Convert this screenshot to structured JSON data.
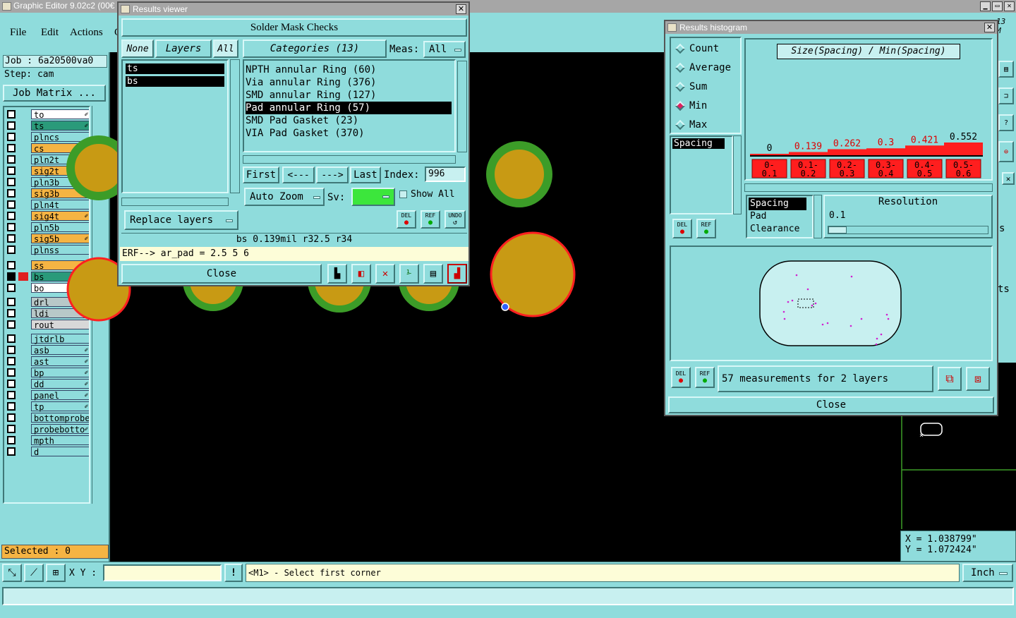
{
  "app": {
    "title": "Graphic Editor 9.02c2 (00€",
    "menu": [
      "File",
      "Edit",
      "Actions",
      "O"
    ]
  },
  "job": {
    "job": "Job : 6a20500va0",
    "step": "Step: cam",
    "matrix": "Job Matrix ..."
  },
  "layers": [
    {
      "name": "to",
      "color": "#ffffff",
      "edit": "✐"
    },
    {
      "name": "ts",
      "color": "#2a9a7a",
      "edit": "✐"
    },
    {
      "name": "plncs",
      "color": "#8fdcdc",
      "edit": ""
    },
    {
      "name": "cs",
      "color": "#f5b443",
      "edit": "✐"
    },
    {
      "name": "pln2t",
      "color": "#8fdcdc",
      "edit": ""
    },
    {
      "name": "sig2t",
      "color": "#f5b443",
      "edit": "✐"
    },
    {
      "name": "pln3b",
      "color": "#8fdcdc",
      "edit": ""
    },
    {
      "name": "sig3b",
      "color": "#f5b443",
      "edit": "✐"
    },
    {
      "name": "pln4t",
      "color": "#8fdcdc",
      "edit": ""
    },
    {
      "name": "sig4t",
      "color": "#f5b443",
      "edit": "✐"
    },
    {
      "name": "pln5b",
      "color": "#8fdcdc",
      "edit": ""
    },
    {
      "name": "sig5b",
      "color": "#f5b443",
      "edit": "✐"
    },
    {
      "name": "plnss",
      "color": "#8fdcdc",
      "edit": ""
    },
    {
      "name": "ss",
      "color": "#f5b443",
      "edit": "✐"
    },
    {
      "name": "bs",
      "color": "#2a9a7a",
      "edit": "✐⊞"
    },
    {
      "name": "bo",
      "color": "#ffffff",
      "edit": "✐"
    },
    {
      "name": "drl",
      "color": "#b8c8c8",
      "edit": ""
    },
    {
      "name": "ldi",
      "color": "#b8c8c8",
      "edit": ""
    },
    {
      "name": "rout",
      "color": "#d8d8d8",
      "edit": ""
    },
    {
      "name": "jtdrlb",
      "color": "#8fdcdc",
      "edit": ""
    },
    {
      "name": "asb",
      "color": "#8fdcdc",
      "edit": "✐"
    },
    {
      "name": "ast",
      "color": "#8fdcdc",
      "edit": "✐"
    },
    {
      "name": "bp",
      "color": "#8fdcdc",
      "edit": "✐"
    },
    {
      "name": "dd",
      "color": "#8fdcdc",
      "edit": "✐"
    },
    {
      "name": "panel",
      "color": "#8fdcdc",
      "edit": "✐"
    },
    {
      "name": "tp",
      "color": "#8fdcdc",
      "edit": "✐"
    },
    {
      "name": "bottomprobe",
      "color": "#8fdcdc",
      "edit": ""
    },
    {
      "name": "probebotto",
      "color": "#8fdcdc",
      "edit": "✐"
    },
    {
      "name": "mpth",
      "color": "#8fdcdc",
      "edit": ""
    },
    {
      "name": "d",
      "color": "#8fdcdc",
      "edit": ""
    }
  ],
  "selected": "Selected : 0",
  "bottom": {
    "xy_label": "X Y :",
    "xy_value": "",
    "excl": "!",
    "prompt": "<M1> - Select first corner",
    "units": "Inch"
  },
  "coords": {
    "x": "X = 1.038799\"",
    "y": "Y = 1.072424\""
  },
  "corner_text": "13\nM",
  "right_edge": {
    "s": "s",
    "ts": "ts"
  },
  "results_viewer": {
    "title": "Results viewer",
    "heading": "Solder Mask Checks",
    "none": "None",
    "layers": "Layers",
    "all": "All",
    "categories": "Categories (13)",
    "meas_label": "Meas:",
    "meas_value": "All",
    "layer_list": [
      "ts",
      "bs"
    ],
    "category_list": [
      "NPTH annular Ring (60)",
      "Via annular Ring (376)",
      "SMD annular Ring (127)",
      "Pad annular Ring (57)",
      "SMD Pad Gasket (23)",
      "VIA Pad Gasket (370)"
    ],
    "selected_category": "Pad annular Ring (57)",
    "first": "First",
    "prev": "<---",
    "next": "--->",
    "last": "Last",
    "index_label": "Index:",
    "index_value": "996",
    "auto_zoom": "Auto Zoom",
    "sv": "Sv:",
    "show_all": "Show All",
    "replace_layers": "Replace layers",
    "del": "DEL",
    "ref": "REF",
    "undo": "UNDO",
    "status": "bs 0.139mil  r32.5  r34",
    "erf": "ERF--> ar_pad = 2.5 5 6",
    "close": "Close"
  },
  "histogram": {
    "title": "Results histogram",
    "modes": [
      "Count",
      "Average",
      "Sum",
      "Min",
      "Max"
    ],
    "selected_mode": "Min",
    "header": "Size(Spacing) / Min(Spacing)",
    "bars": [
      {
        "value": 0,
        "label": "0",
        "bin": "0-\n0.1"
      },
      {
        "value": 0.139,
        "label": "0.139",
        "bin": "0.1-\n0.2"
      },
      {
        "value": 0.262,
        "label": "0.262",
        "bin": "0.2-\n0.3"
      },
      {
        "value": 0.3,
        "label": "0.3",
        "bin": "0.3-\n0.4"
      },
      {
        "value": 0.421,
        "label": "0.421",
        "bin": "0.4-\n0.5"
      },
      {
        "value": 0.552,
        "label": "0.552",
        "bin": "0.5-\n0.6"
      }
    ],
    "measure_list": [
      "Spacing"
    ],
    "type_list": [
      "Spacing",
      "Pad",
      "Clearance"
    ],
    "resolution_label": "Resolution",
    "resolution_value": "0.1",
    "del": "DEL",
    "ref": "REF",
    "summary": "57 measurements for 2 layers",
    "close": "Close"
  }
}
